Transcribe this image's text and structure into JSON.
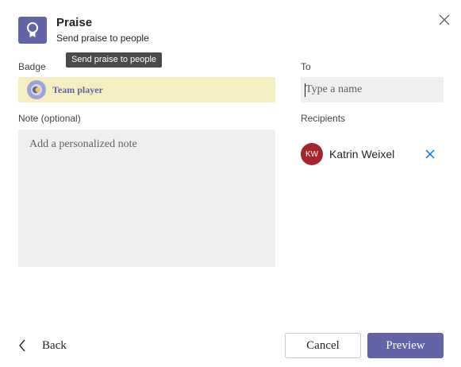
{
  "header": {
    "title": "Praise",
    "subtitle": "Send praise to people"
  },
  "tooltip": {
    "text": "Send praise to people"
  },
  "badge": {
    "label": "Badge",
    "selected": "Team player"
  },
  "to": {
    "label": "To",
    "placeholder": "Type a name"
  },
  "note": {
    "label": "Note (optional)",
    "placeholder": "Add a personalized note"
  },
  "recipients": {
    "label": "Recipients",
    "items": [
      {
        "initials": "KW",
        "name": "Katrin Weixel",
        "avatar_color": "#a4262c"
      }
    ]
  },
  "footer": {
    "back_label": "Back",
    "cancel_label": "Cancel",
    "preview_label": "Preview"
  },
  "icons": {
    "app": "award-ribbon-icon",
    "close": "close-icon",
    "badge": "team-player-badge-icon",
    "remove": "remove-recipient-icon",
    "back": "chevron-left-icon"
  },
  "colors": {
    "accent": "#6264a7",
    "badge_background": "#f5eec0",
    "input_background": "#f0efee",
    "avatar": "#a4262c"
  }
}
